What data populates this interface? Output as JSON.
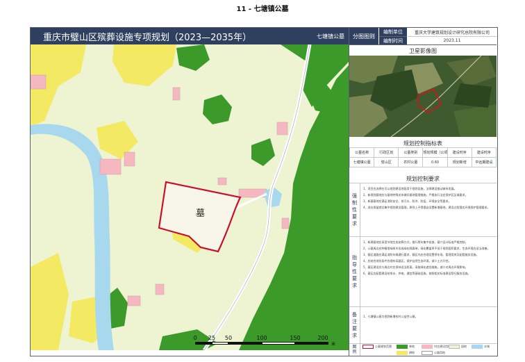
{
  "page_title": "11 - 七塘镇公墓",
  "header": {
    "plan_title": "重庆市璧山区殡葬设施专项规划（2023—2035年）",
    "site_name": "七塘镇公墓"
  },
  "map": {
    "grave_label": "墓",
    "scale": {
      "ticks": [
        "0",
        "25",
        "50",
        "100",
        "150",
        "200"
      ],
      "unit": "米"
    }
  },
  "side": {
    "drawing_label": "分图图则",
    "unit_label": "编制单位",
    "unit_value": "重庆大学建筑规划设计研究总院有限公司",
    "time_label": "编制时间",
    "time_value": "2023.11",
    "satellite_title": "卫星影像图",
    "index_title": "规划控制指标表",
    "index_headers": [
      "公墓名称",
      "行政区划",
      "公墓类别",
      "规划规模（公顷）",
      "建设时序",
      "建设时序"
    ],
    "index_row": [
      "七塘镇公墓",
      "璧山区",
      "农村公墓",
      "0.60",
      "规划新增",
      "中远期建设"
    ],
    "requirements_title": "规划控制要求",
    "mandatory": {
      "label": [
        "强",
        "制",
        "性",
        "要",
        "求"
      ],
      "items": [
        "1、项目应选择在可以规划建设地段用于规划设施，法律建设推动城市发展。",
        "2、新规划墓地应与墓地特殊关系做好墓地管理措施，严格执行法定保护区区域要求。",
        "3、新墓墓地应满足消防安全、排污水、防洪、防疫、环境安全等要求。",
        "4、选址保留就近集中规划建设管理，原则上不得擅自设置新增墓地，建设过程落实环境保护管理要求。"
      ]
    },
    "guidance": {
      "label": [
        "指",
        "导",
        "性",
        "要",
        "求"
      ],
      "items": [
        "1、新建墓地应采用节地生态安葬方式，推行骨灰集中安放，墓穴设计标准严格控制。",
        "2、公墓周边应种植常绿树木形成绿化隔离带，绿化覆盖率不低于规划面积要求，生态环境应适当改善。",
        "3、墓区道路应满足消防车辆通行要求，墓区内应合理设置停车场、管理用房及配套服务设施。",
        "4、应结合地形条件合理布局墓区，保护自然生态环境，减少土方开挖。",
        "5、墓区建设应与周边村庄保持适当距离，采取绿化遮挡措施，减少对周边环境影响。",
        "6、墓区应配套建设给排水、供电、通信等基础设施，按照相关标准建设祭扫服务设施。"
      ]
    },
    "remarks": {
      "label": [
        "备",
        "注",
        "要",
        "求"
      ],
      "text": "1、七塘镇公墓为规划新增农村公益性公墓。"
    },
    "legend": {
      "label": [
        "图",
        "例"
      ],
      "items": [
        {
          "text": "公墓规划范围",
          "swatch": "boundary"
        },
        {
          "text": "林地",
          "swatch": "#3c9a2b"
        },
        {
          "text": "村庄建设用地",
          "swatch": "#f5b7c0"
        },
        {
          "text": "园地",
          "swatch": "#eef3d2"
        },
        {
          "text": "水域",
          "swatch": "#a8d8ee"
        },
        {
          "text": "耕地",
          "swatch": "#f3e963"
        },
        {
          "text": "公路用地",
          "swatch": "#ffffff"
        }
      ]
    }
  },
  "colors": {
    "header": "#2f3f5f",
    "forest": "#3c9a2b",
    "farmland": "#f3e963",
    "garden": "#eef3d2",
    "village": "#f5b7c0",
    "water": "#a8d8ee",
    "boundary": "#c8102e"
  }
}
